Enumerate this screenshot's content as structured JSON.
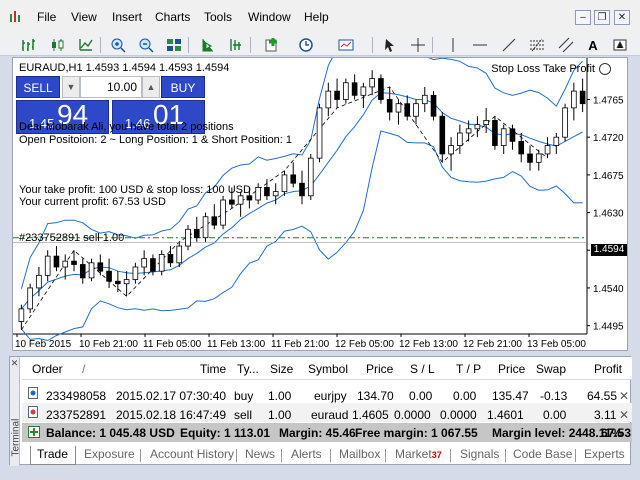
{
  "menu": [
    "File",
    "View",
    "Insert",
    "Charts",
    "Tools",
    "Window",
    "Help"
  ],
  "window_buttons": {
    "minimize": "–",
    "restore": "❐",
    "close": "✕"
  },
  "toolbar_text": {
    "text_tool": "A"
  },
  "chart": {
    "symbol_header": "EURAUD,H1  1.4593 1.4594 1.4593 1.4594",
    "expert_name": "Stop Loss Take Profit",
    "sell_label": "SELL",
    "buy_label": "BUY",
    "lot_value": "10.00",
    "spin_down": "▼",
    "spin_up": "▲",
    "bid_small": "1.45",
    "bid_big": "94",
    "ask_small": "1.46",
    "ask_big": "01",
    "info_greeting": "Dear Mobarak Ali, you have total 2 positions",
    "info_open": "Open Positoion: 2 ~ Long Position: 1 & Short Position: 1",
    "info_tp_sl": "Your take profit: 100 USD & stop loss: 100 USD",
    "info_profit": "Your current profit: 67.53 USD",
    "sell_line_label": "#233752891 sell 1.00",
    "current_price_tag": "1.4594",
    "price_axis": [
      "1.4765",
      "1.4720",
      "1.4675",
      "1.4630",
      "1.4585",
      "1.4540",
      "1.4495"
    ],
    "time_axis": [
      "10 Feb 2015",
      "10 Feb 21:00",
      "11 Feb 05:00",
      "11 Feb 13:00",
      "11 Feb 21:00",
      "12 Feb 05:00",
      "12 Feb 13:00",
      "12 Feb 21:00",
      "13 Feb 05:00"
    ]
  },
  "chart_data": {
    "type": "candlestick",
    "symbol": "EURAUD",
    "timeframe": "H1",
    "ylim": [
      1.4485,
      1.4805
    ],
    "sell_line": 1.46,
    "current_bid": 1.4594,
    "candles": [
      [
        1.45,
        1.452,
        1.449,
        1.4515
      ],
      [
        1.4515,
        1.4545,
        1.451,
        1.454
      ],
      [
        1.454,
        1.4565,
        1.453,
        1.4555
      ],
      [
        1.4555,
        1.4585,
        1.4548,
        1.4578
      ],
      [
        1.4578,
        1.459,
        1.456,
        1.4565
      ],
      [
        1.4565,
        1.458,
        1.455,
        1.4572
      ],
      [
        1.4572,
        1.4585,
        1.456,
        1.4568
      ],
      [
        1.4568,
        1.4575,
        1.4545,
        1.4552
      ],
      [
        1.4552,
        1.4575,
        1.4548,
        1.457
      ],
      [
        1.457,
        1.458,
        1.4555,
        1.456
      ],
      [
        1.456,
        1.4575,
        1.454,
        1.4548
      ],
      [
        1.4548,
        1.456,
        1.4535,
        1.4545
      ],
      [
        1.4545,
        1.456,
        1.453,
        1.455
      ],
      [
        1.455,
        1.457,
        1.4545,
        1.4565
      ],
      [
        1.4565,
        1.4585,
        1.4555,
        1.4575
      ],
      [
        1.4575,
        1.458,
        1.4555,
        1.456
      ],
      [
        1.456,
        1.4585,
        1.4555,
        1.458
      ],
      [
        1.458,
        1.459,
        1.4565,
        1.457
      ],
      [
        1.457,
        1.4595,
        1.4565,
        1.459
      ],
      [
        1.459,
        1.4615,
        1.4585,
        1.461
      ],
      [
        1.461,
        1.4625,
        1.4595,
        1.46
      ],
      [
        1.46,
        1.463,
        1.4595,
        1.4625
      ],
      [
        1.4625,
        1.464,
        1.461,
        1.4615
      ],
      [
        1.4615,
        1.465,
        1.461,
        1.4645
      ],
      [
        1.4645,
        1.466,
        1.4635,
        1.464
      ],
      [
        1.464,
        1.4655,
        1.4625,
        1.465
      ],
      [
        1.465,
        1.466,
        1.4635,
        1.4645
      ],
      [
        1.4645,
        1.4665,
        1.464,
        1.466
      ],
      [
        1.466,
        1.467,
        1.4645,
        1.465
      ],
      [
        1.465,
        1.4665,
        1.464,
        1.4655
      ],
      [
        1.4655,
        1.468,
        1.465,
        1.4675
      ],
      [
        1.4675,
        1.469,
        1.466,
        1.4665
      ],
      [
        1.4665,
        1.468,
        1.464,
        1.465
      ],
      [
        1.465,
        1.47,
        1.4645,
        1.4695
      ],
      [
        1.4695,
        1.476,
        1.469,
        1.4755
      ],
      [
        1.4755,
        1.4785,
        1.4745,
        1.4775
      ],
      [
        1.4775,
        1.479,
        1.4755,
        1.4765
      ],
      [
        1.4765,
        1.479,
        1.476,
        1.4785
      ],
      [
        1.4785,
        1.4795,
        1.4765,
        1.477
      ],
      [
        1.477,
        1.4785,
        1.4755,
        1.478
      ],
      [
        1.478,
        1.48,
        1.477,
        1.479
      ],
      [
        1.479,
        1.4795,
        1.476,
        1.4765
      ],
      [
        1.4765,
        1.478,
        1.474,
        1.475
      ],
      [
        1.475,
        1.4765,
        1.4735,
        1.476
      ],
      [
        1.476,
        1.477,
        1.474,
        1.4745
      ],
      [
        1.4745,
        1.4765,
        1.4735,
        1.476
      ],
      [
        1.476,
        1.478,
        1.475,
        1.477
      ],
      [
        1.477,
        1.4775,
        1.474,
        1.4745
      ],
      [
        1.4745,
        1.475,
        1.469,
        1.47
      ],
      [
        1.47,
        1.472,
        1.468,
        1.471
      ],
      [
        1.471,
        1.4735,
        1.47,
        1.4725
      ],
      [
        1.4725,
        1.474,
        1.4715,
        1.473
      ],
      [
        1.473,
        1.4745,
        1.472,
        1.4735
      ],
      [
        1.4735,
        1.4755,
        1.4725,
        1.474
      ],
      [
        1.474,
        1.4745,
        1.4705,
        1.471
      ],
      [
        1.471,
        1.4735,
        1.47,
        1.473
      ],
      [
        1.473,
        1.4735,
        1.4705,
        1.4715
      ],
      [
        1.4715,
        1.4725,
        1.469,
        1.47
      ],
      [
        1.47,
        1.471,
        1.468,
        1.469
      ],
      [
        1.469,
        1.4705,
        1.468,
        1.47
      ],
      [
        1.47,
        1.472,
        1.4695,
        1.471
      ],
      [
        1.471,
        1.4725,
        1.47,
        1.472
      ],
      [
        1.472,
        1.476,
        1.4715,
        1.4755
      ],
      [
        1.4755,
        1.4785,
        1.474,
        1.4775
      ],
      [
        1.4775,
        1.479,
        1.475,
        1.476
      ]
    ]
  },
  "terminal": {
    "side_label": "Terminal",
    "close_glyph": "✕",
    "headers": [
      "Order",
      "Time",
      "Ty...",
      "Size",
      "Symbol",
      "Price",
      "S / L",
      "T / P",
      "Price",
      "Swap",
      "Profit"
    ],
    "sort_glyph": "/",
    "rows": [
      [
        "233498058",
        "2015.02.17 07:30:40",
        "buy",
        "1.00",
        "eurjpy",
        "134.70",
        "0.00",
        "0.00",
        "135.47",
        "-0.13",
        "64.55"
      ],
      [
        "233752891",
        "2015.02.18 16:47:49",
        "sell",
        "1.00",
        "euraud",
        "1.4605",
        "0.0000",
        "0.0000",
        "1.4601",
        "0.00",
        "3.11"
      ]
    ],
    "row_close": "✕",
    "balance": {
      "balance": "Balance: 1 045.48 USD",
      "equity": "Equity: 1 113.01",
      "margin": "Margin: 45.46",
      "free_margin": "Free margin: 1 067.55",
      "margin_level": "Margin level: 2448.11%",
      "total": "67.53"
    },
    "tabs": [
      "Trade",
      "Exposure",
      "Account History",
      "News",
      "Alerts",
      "Mailbox",
      "Market",
      "Signals",
      "Code Base",
      "Experts"
    ],
    "market_badge": "37"
  },
  "colors": {
    "accent": "#2d49c7",
    "band": "#1f6fd1",
    "sell_line": "#1a7a2a",
    "candle": "#000000"
  }
}
